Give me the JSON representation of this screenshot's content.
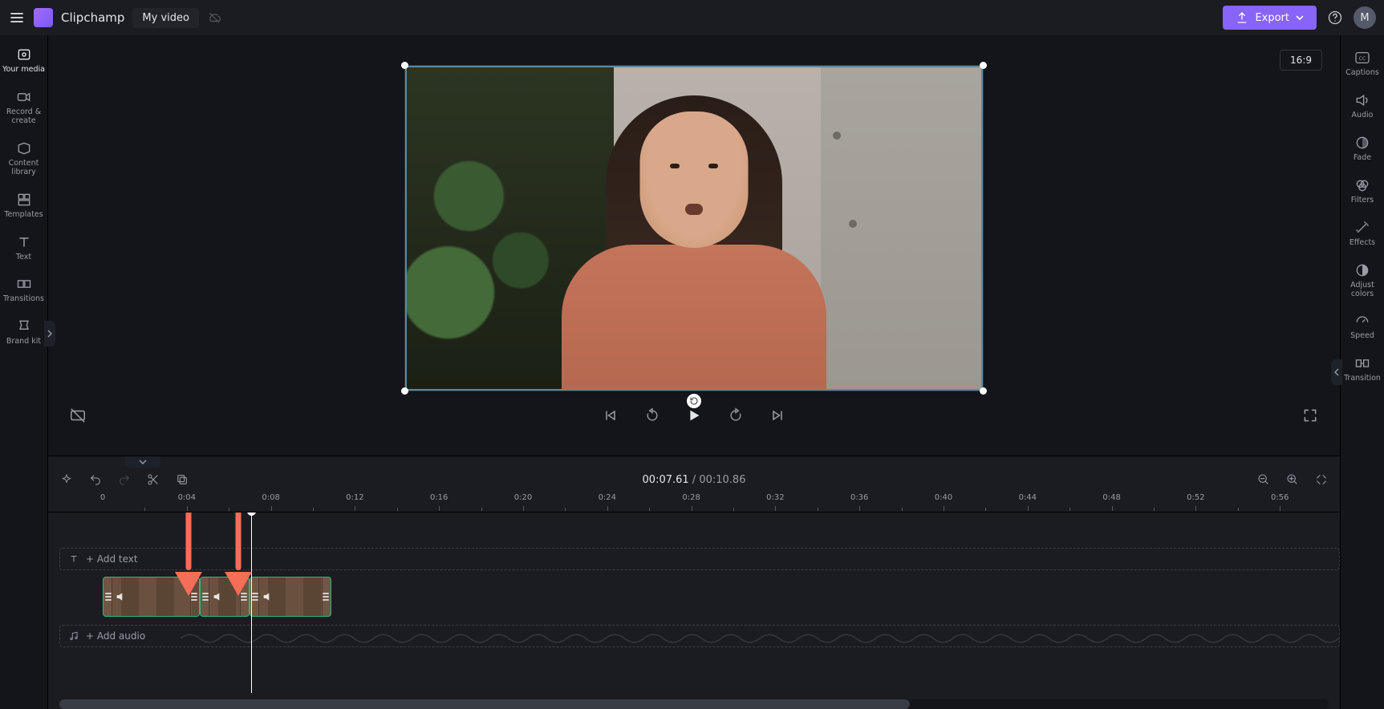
{
  "header": {
    "app_name": "Clipchamp",
    "project_name": "My video",
    "export_label": "Export",
    "avatar_initial": "M"
  },
  "left_rail": {
    "items": [
      {
        "id": "your-media",
        "label": "Your media"
      },
      {
        "id": "record-create",
        "label": "Record & create"
      },
      {
        "id": "content-library",
        "label": "Content library"
      },
      {
        "id": "templates",
        "label": "Templates"
      },
      {
        "id": "text",
        "label": "Text"
      },
      {
        "id": "transitions",
        "label": "Transitions"
      },
      {
        "id": "brand-kit",
        "label": "Brand kit"
      }
    ]
  },
  "preview": {
    "aspect_label": "16:9"
  },
  "right_rail": {
    "items": [
      {
        "id": "captions",
        "label": "Captions"
      },
      {
        "id": "audio",
        "label": "Audio"
      },
      {
        "id": "fade",
        "label": "Fade"
      },
      {
        "id": "filters",
        "label": "Filters"
      },
      {
        "id": "effects",
        "label": "Effects"
      },
      {
        "id": "adjust-colors",
        "label": "Adjust colors"
      },
      {
        "id": "speed",
        "label": "Speed"
      },
      {
        "id": "transition",
        "label": "Transition"
      }
    ]
  },
  "timeline": {
    "current_time": "00:07.61",
    "total_time": "00:10.86",
    "separator": " / ",
    "add_text_label": "+ Add text",
    "add_audio_label": "+ Add audio",
    "ruler_start": "0",
    "ruler_ticks": [
      "0:04",
      "0:08",
      "0:12",
      "0:16",
      "0:20",
      "0:24",
      "0:28",
      "0:32",
      "0:36",
      "0:40",
      "0:44",
      "0:48",
      "0:52",
      "0:56"
    ],
    "playhead_seconds": 7.61,
    "clips": [
      {
        "start": 0.0,
        "end": 4.6
      },
      {
        "start": 4.6,
        "end": 7.0
      },
      {
        "start": 7.0,
        "end": 10.86
      }
    ],
    "scroll_thumb_pct": 67
  }
}
